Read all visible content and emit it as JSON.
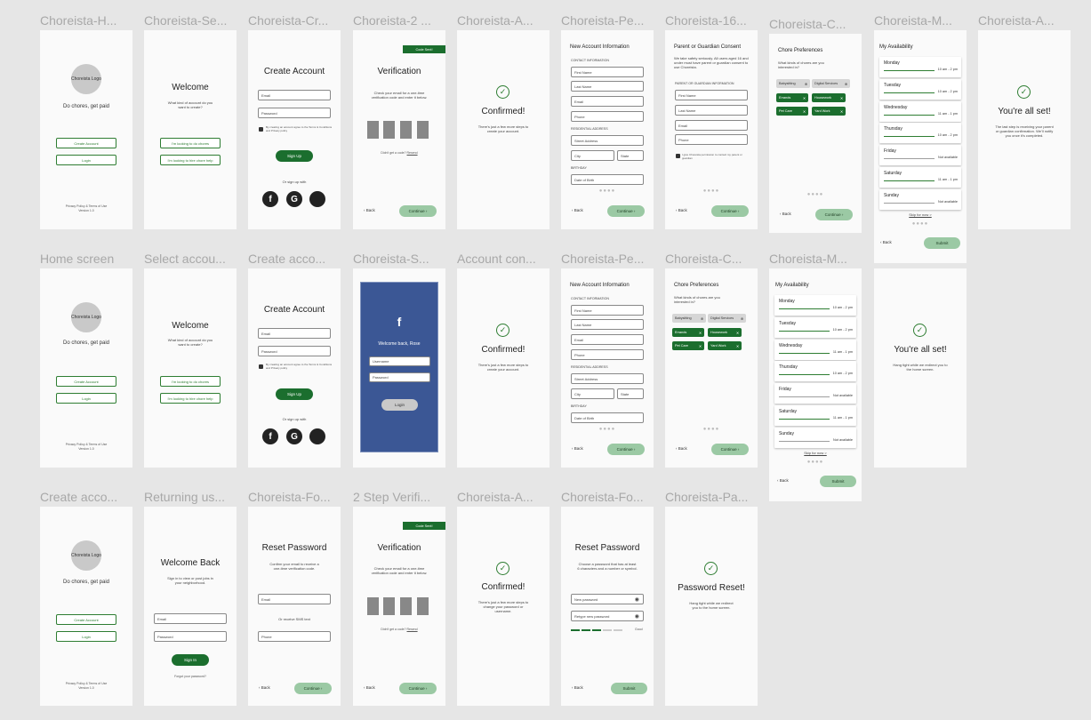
{
  "colors": {
    "brand_green": "#1b6e2e",
    "light_green": "#9bc9a4",
    "facebook_blue": "#3b5795",
    "canvas": "#e6e6e6"
  },
  "row1_labels": [
    "Choreista-H...",
    "Choreista-Se...",
    "Choreista-Cr...",
    "Choreista-2 ...",
    "Choreista-A...",
    "Choreista-Pe...",
    "Choreista-16...",
    "Choreista-C...",
    "Choreista-M...",
    "Choreista-A..."
  ],
  "row2_labels": [
    "Home screen",
    "Select accou...",
    "Create acco...",
    "Choreista-S...",
    "Account con...",
    "Choreista-Pe...",
    "Choreista-C...",
    "Choreista-M...",
    "Account con..."
  ],
  "row3_labels": [
    "Create acco...",
    "Returning us...",
    "Choreista-Fo...",
    "2 Step Verifi...",
    "Choreista-A...",
    "Choreista-Fo...",
    "Choreista-Pa..."
  ],
  "home": {
    "logo": "Choreista Logo",
    "tagline": "Do chores, get paid",
    "create_btn": "Create Account",
    "login_btn": "Login",
    "footer": "Privacy Policy & Terms of Use",
    "version": "Version 1.0"
  },
  "select": {
    "title": "Welcome",
    "subtitle": "What kind of account do you want to create?",
    "opt1": "I'm looking to do chores",
    "opt2": "I'm looking to hire chore help"
  },
  "create": {
    "title": "Create Account",
    "email": "Email",
    "password": "Password",
    "terms": "By creating an account agree to the Terms & Conditions and Privacy policy",
    "signup": "Sign Up",
    "or_signup": "Or sign up with",
    "fb": "f",
    "google": "G",
    "apple": ""
  },
  "verify": {
    "badge": "Code Sent!",
    "title": "Verification",
    "body": "Check your email for a one-time verification code and enter it below.",
    "resend": "Didn't get a code?",
    "resend_link": "Resend",
    "back": "Back",
    "continue": "Continue"
  },
  "confirmed": {
    "title": "Confirmed!",
    "body": "There's just a few more steps to create your account.",
    "body2": "There's just a few more steps to change your password or username."
  },
  "personal": {
    "title": "New Account Information",
    "contact": "CONTACT INFORMATION",
    "first": "First Name",
    "last": "Last Name",
    "email": "Email",
    "phone": "Phone",
    "residential": "RESIDENTIAL ADDRESS",
    "street": "Street Address",
    "city": "City",
    "state": "State",
    "birthday": "BIRTHDAY",
    "dob": "Date of Birth"
  },
  "consent": {
    "title": "Parent or Guardian Consent",
    "body": "We take safety seriously. All users aged 16 and under must have parent or guardian consent to use Choreista.",
    "section": "PARENT OR GUARDIAN INFORMATION",
    "first": "First Name",
    "last": "Last Name",
    "email": "Email",
    "phone": "Phone",
    "check": "I give Choreista permission to contact my parent or guardian"
  },
  "chores": {
    "title": "Chore Preferences",
    "question": "What kinds of chores are you interested in?",
    "c1": "Babysitting",
    "c2": "Digital Services",
    "c3": "Errands",
    "c4": "Housework",
    "c5": "Pet Care",
    "c6": "Yard Work"
  },
  "avail": {
    "title": "My Availability",
    "days": [
      {
        "name": "Monday",
        "time": "10 am - 2 pm"
      },
      {
        "name": "Tuesday",
        "time": "10 am - 2 pm"
      },
      {
        "name": "Wednesday",
        "time": "11 am - 1 pm"
      },
      {
        "name": "Thursday",
        "time": "10 am - 2 pm"
      },
      {
        "name": "Friday",
        "time": "Not available"
      },
      {
        "name": "Saturday",
        "time": "11 am - 1 pm"
      },
      {
        "name": "Sunday",
        "time": "Not available"
      }
    ],
    "skip": "Skip for now >",
    "submit": "Submit"
  },
  "allset": {
    "title": "You're all set!",
    "body1": "The last step is receiving your parent or guardian confirmation. We'll notify you once it's completed.",
    "body2": "Hang tight while we redirect you to the home screen."
  },
  "signin_fb": {
    "title": "Welcome back, Rose",
    "user": "Username",
    "pass": "Password",
    "login": "Login"
  },
  "returning": {
    "title": "Welcome Back",
    "subtitle": "Sign in to view or post jobs in your neighborhood.",
    "email": "Email",
    "password": "Password",
    "signin": "Sign In",
    "forgot": "Forgot your password?"
  },
  "reset": {
    "title": "Reset Password",
    "body": "Confirm your email to receive a one-time verification code.",
    "email": "Email",
    "or_sms": "Or receive SMS text",
    "phone": "Phone",
    "body2": "Choose a password that has at least 6 characters and a number or symbol.",
    "newpw": "New password",
    "retype": "Retype new password",
    "strength": "Good",
    "submit": "Submit"
  },
  "pwreset": {
    "title": "Password Reset!",
    "body": "Hang tight while we redirect you to the home screen."
  }
}
